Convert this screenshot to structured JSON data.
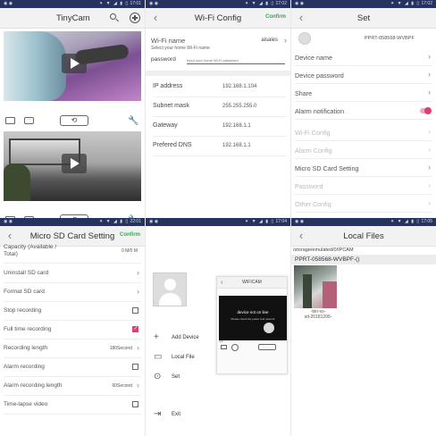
{
  "panel1": {
    "status": {
      "time": "17:01",
      "icons": "⁕ ▼ ◢ ▮ ▯"
    },
    "title": "TinyCam",
    "ptz_label": "⟲"
  },
  "panel2": {
    "status": {
      "time": "17:02",
      "icons": "⁕ ▼ ◢ ▮ ▯"
    },
    "title": "Wi-Fi Config",
    "confirm": "Confirm",
    "wifi_name_label": "Wi-Fi name",
    "wifi_name_value": "aisales",
    "wifi_hint": "Select your home Wi-Fi name",
    "password_label": "password",
    "password_placeholder": "Input your home Wi-Fi password",
    "network": [
      {
        "key": "IP address",
        "value": "192.168.1.104"
      },
      {
        "key": "Subnet mask",
        "value": "255.255.255.0"
      },
      {
        "key": "Gateway",
        "value": "192.168.1.1"
      },
      {
        "key": "Prefered DNS",
        "value": "192.168.1.1"
      }
    ]
  },
  "panel3": {
    "status": {
      "time": "17:02",
      "icons": "⁕ ▼ ◢ ▮ ▯"
    },
    "title": "Set",
    "device_id": "PPRT-058568-WVBPF",
    "rows": [
      {
        "label": "Device name",
        "disabled": false
      },
      {
        "label": "Device password",
        "disabled": false
      },
      {
        "label": "Share",
        "disabled": false
      },
      {
        "label": "Alarm notification",
        "toggle": true,
        "on": true
      },
      {
        "label": "Wi-Fi Config",
        "disabled": true
      },
      {
        "label": "Alarm Config",
        "disabled": true
      },
      {
        "label": "Micro SD Card Setting",
        "disabled": false
      },
      {
        "label": "Password",
        "disabled": true
      },
      {
        "label": "Other Config",
        "disabled": true
      }
    ]
  },
  "panel4": {
    "status": {
      "time": "22:01",
      "icons": "⁕ ▼ ◢ ▮ ▯"
    },
    "title": "Micro SD Card Setting",
    "confirm": "Confirm",
    "capacity_label_1": "Capacity (Available /",
    "capacity_label_2": "Total)",
    "capacity_value": "0 M/0 M",
    "rows": [
      {
        "label": "Uninstall SD card",
        "kind": "chev"
      },
      {
        "label": "Format SD card",
        "kind": "chev"
      },
      {
        "label": "Stop recording",
        "kind": "check",
        "checked": false
      },
      {
        "label": "Full time recording",
        "kind": "check",
        "checked": true
      },
      {
        "label": "Recording length",
        "kind": "value",
        "value": "180Second"
      },
      {
        "label": "Alarm recording",
        "kind": "check",
        "checked": false
      },
      {
        "label": "Alarm recording length",
        "kind": "value",
        "value": "60Second"
      },
      {
        "label": "Time-lapse video",
        "kind": "check",
        "checked": false
      }
    ]
  },
  "panel5": {
    "status": {
      "time": "17:04",
      "icons": "⁕ ▼ ◢ ▮ ▯"
    },
    "menu": [
      {
        "label": "Add Device",
        "icon": "+"
      },
      {
        "label": "Local File",
        "icon": "▭"
      },
      {
        "label": "Set",
        "icon": "⊙"
      },
      {
        "label": "Exit",
        "icon": "⇥"
      }
    ],
    "mini_title": "WIFICAM",
    "mini_offline": "device not on line",
    "mini_hint": "Please check the power and network",
    "mini_sub": "null"
  },
  "panel6": {
    "status": {
      "time": "17:05",
      "icons": "⁕ ▼ ◢ ▮ ▯"
    },
    "title": "Local Files",
    "path": "/storage/emulated/0/IPCAM",
    "device_group": "PPRT-058568-WVBPF-()",
    "thumb_caption_1": "-bin-vs-",
    "thumb_caption_2": "sd-20181206-"
  },
  "colors": {
    "status_bar": "#26325f",
    "confirm_green": "#34a853",
    "accent_pink": "#e0406f"
  }
}
